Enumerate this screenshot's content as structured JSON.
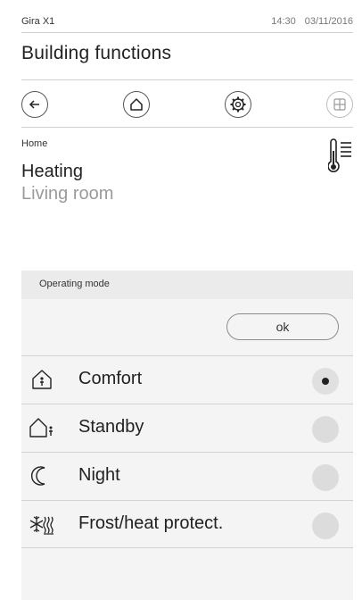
{
  "status_bar": {
    "device": "Gira X1",
    "time": "14:30",
    "date": "03/11/2016"
  },
  "header": {
    "title": "Building functions"
  },
  "nav": {
    "items": [
      {
        "name": "back",
        "icon": "back-arrow-icon"
      },
      {
        "name": "home",
        "icon": "home-icon"
      },
      {
        "name": "settings",
        "icon": "gear-icon"
      },
      {
        "name": "grid",
        "icon": "grid-icon"
      }
    ]
  },
  "breadcrumb": "Home",
  "function": {
    "title": "Heating",
    "location": "Living room",
    "icon": "thermometer-icon"
  },
  "operating_mode": {
    "header": "Operating mode",
    "ok_label": "ok",
    "options": [
      {
        "label": "Comfort",
        "icon": "house-person-icon",
        "selected": true
      },
      {
        "label": "Standby",
        "icon": "house-person-outside-icon",
        "selected": false
      },
      {
        "label": "Night",
        "icon": "moon-icon",
        "selected": false
      },
      {
        "label": "Frost/heat protect.",
        "icon": "frost-heat-icon",
        "selected": false
      }
    ]
  },
  "colors": {
    "panel_header": "#ebebeb",
    "panel_body": "#f4f4f4",
    "radio": "#dcdcdc",
    "muted_text": "#9a9a9a"
  }
}
